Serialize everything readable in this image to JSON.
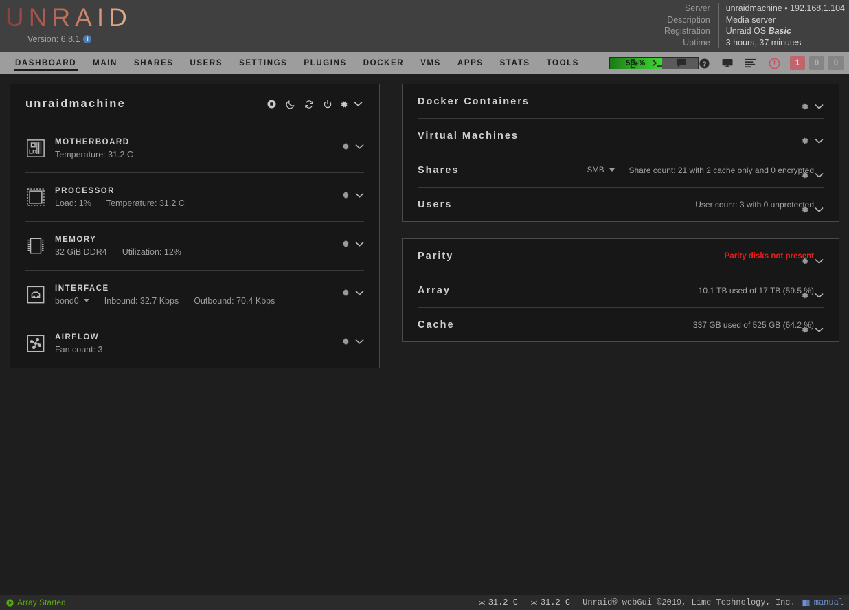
{
  "header": {
    "logo": "UNRAID",
    "version_label": "Version: 6.8.1",
    "info_icon_char": "i",
    "server_info": [
      {
        "label": "Server",
        "value": "unraidmachine • 192.168.1.104",
        "emphasis": ""
      },
      {
        "label": "Description",
        "value": "Media server",
        "emphasis": ""
      },
      {
        "label": "Registration",
        "value": "Unraid OS ",
        "emphasis": "Basic"
      },
      {
        "label": "Uptime",
        "value": "3 hours, 37 minutes",
        "emphasis": ""
      }
    ]
  },
  "nav": {
    "items": [
      {
        "label": "DASHBOARD",
        "active": true
      },
      {
        "label": "MAIN",
        "active": false
      },
      {
        "label": "SHARES",
        "active": false
      },
      {
        "label": "USERS",
        "active": false
      },
      {
        "label": "SETTINGS",
        "active": false
      },
      {
        "label": "PLUGINS",
        "active": false
      },
      {
        "label": "DOCKER",
        "active": false
      },
      {
        "label": "VMS",
        "active": false
      },
      {
        "label": "APPS",
        "active": false
      },
      {
        "label": "STATS",
        "active": false
      },
      {
        "label": "TOOLS",
        "active": false
      }
    ],
    "progress": {
      "label": "59 %",
      "percent": 59,
      "fill_color": "#3ed531",
      "track_color": "#5a5a5a"
    },
    "icons": [
      "logout-icon",
      "terminal-icon",
      "feedback-icon",
      "help-icon",
      "display-icon",
      "log-icon",
      "power-icon"
    ],
    "badges": [
      {
        "label": "1",
        "tone": "red"
      },
      {
        "label": "0",
        "tone": "gray"
      },
      {
        "label": "0",
        "tone": "gray"
      }
    ]
  },
  "system_panel": {
    "title": "unraidmachine",
    "actions": [
      "stop-icon",
      "sleep-icon",
      "reboot-icon",
      "power-icon",
      "gear-icon",
      "chevron-down-icon"
    ],
    "devices": [
      {
        "name": "MOTHERBOARD",
        "icon": "motherboard-icon",
        "stats": [
          {
            "text": "Temperature: 31.2 C"
          }
        ]
      },
      {
        "name": "PROCESSOR",
        "icon": "cpu-icon",
        "stats": [
          {
            "text": "Load: 1%"
          },
          {
            "text": "Temperature: 31.2 C"
          }
        ]
      },
      {
        "name": "MEMORY",
        "icon": "memory-icon",
        "stats": [
          {
            "text": "32 GiB DDR4"
          },
          {
            "text": "Utilization: 12%"
          }
        ]
      },
      {
        "name": "INTERFACE",
        "icon": "ethernet-icon",
        "selector": "bond0",
        "stats": [
          {
            "text": "Inbound: 32.7 Kbps"
          },
          {
            "text": "Outbound: 70.4 Kbps"
          }
        ]
      },
      {
        "name": "AIRFLOW",
        "icon": "fan-icon",
        "stats": [
          {
            "text": "Fan count: 3"
          }
        ]
      }
    ]
  },
  "services_card": {
    "rows": [
      {
        "title": "Docker Containers",
        "selector": "",
        "status": "",
        "alert": false
      },
      {
        "title": "Virtual Machines",
        "selector": "",
        "status": "",
        "alert": false
      },
      {
        "title": "Shares",
        "selector": "SMB",
        "status": "Share count: 21 with 2 cache only and 0 encrypted",
        "alert": false
      },
      {
        "title": "Users",
        "selector": "",
        "status": "User count: 3 with 0 unprotected",
        "alert": false
      }
    ]
  },
  "storage_card": {
    "rows": [
      {
        "title": "Parity",
        "selector": "",
        "status": "Parity disks not present",
        "alert": true
      },
      {
        "title": "Array",
        "selector": "",
        "status": "10.1 TB used of 17 TB (59.5 %)",
        "alert": false
      },
      {
        "title": "Cache",
        "selector": "",
        "status": "337 GB used of 525 GB (64.2 %)",
        "alert": false
      }
    ]
  },
  "footer": {
    "array_status": "Array Started",
    "array_status_color": "#57a80f",
    "temps": [
      "31.2 C",
      "31.2 C"
    ],
    "copyright": "Unraid® webGui ©2019, Lime Technology, Inc.",
    "manual_label": "manual"
  }
}
